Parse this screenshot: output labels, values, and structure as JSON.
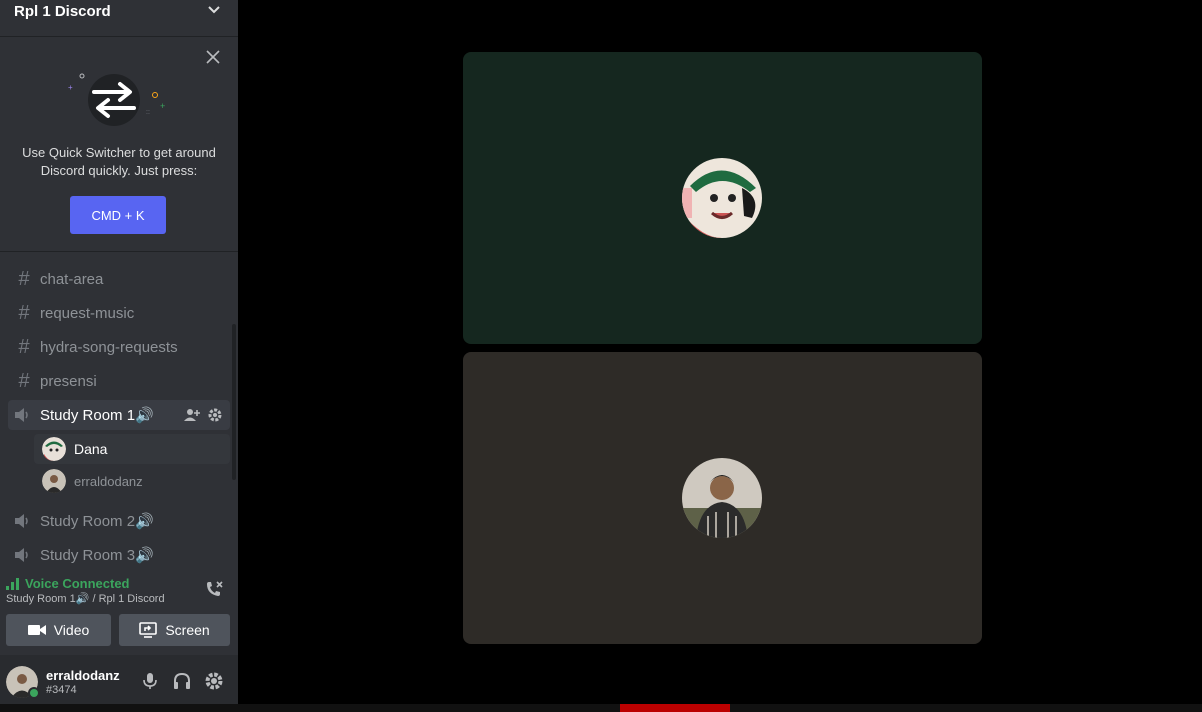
{
  "server": {
    "name": "Rpl 1 Discord"
  },
  "quick_switcher": {
    "text": "Use Quick Switcher to get around Discord quickly. Just press:",
    "shortcut_label": "CMD + K"
  },
  "channels": [
    {
      "type": "text",
      "label": "chat-area"
    },
    {
      "type": "text",
      "label": "request-music"
    },
    {
      "type": "text",
      "label": "hydra-song-requests"
    },
    {
      "type": "text",
      "label": "presensi"
    },
    {
      "type": "voice",
      "label": "Study Room 1🔊"
    },
    {
      "type": "voice",
      "label": "Study Room 2🔊"
    },
    {
      "type": "voice",
      "label": "Study Room 3🔊"
    }
  ],
  "voice_members": [
    {
      "name": "Dana"
    },
    {
      "name": "erraldodanz"
    }
  ],
  "voice_status": {
    "title": "Voice Connected",
    "subtitle": "Study Room 1🔊 / Rpl 1 Discord",
    "video_label": "Video",
    "screen_label": "Screen"
  },
  "user": {
    "name": "erraldodanz",
    "discriminator": "#3474"
  },
  "colors": {
    "accent": "#5865f2",
    "connected": "#3ba55d",
    "tile1": "#15271f",
    "tile2": "#2e2b27"
  }
}
